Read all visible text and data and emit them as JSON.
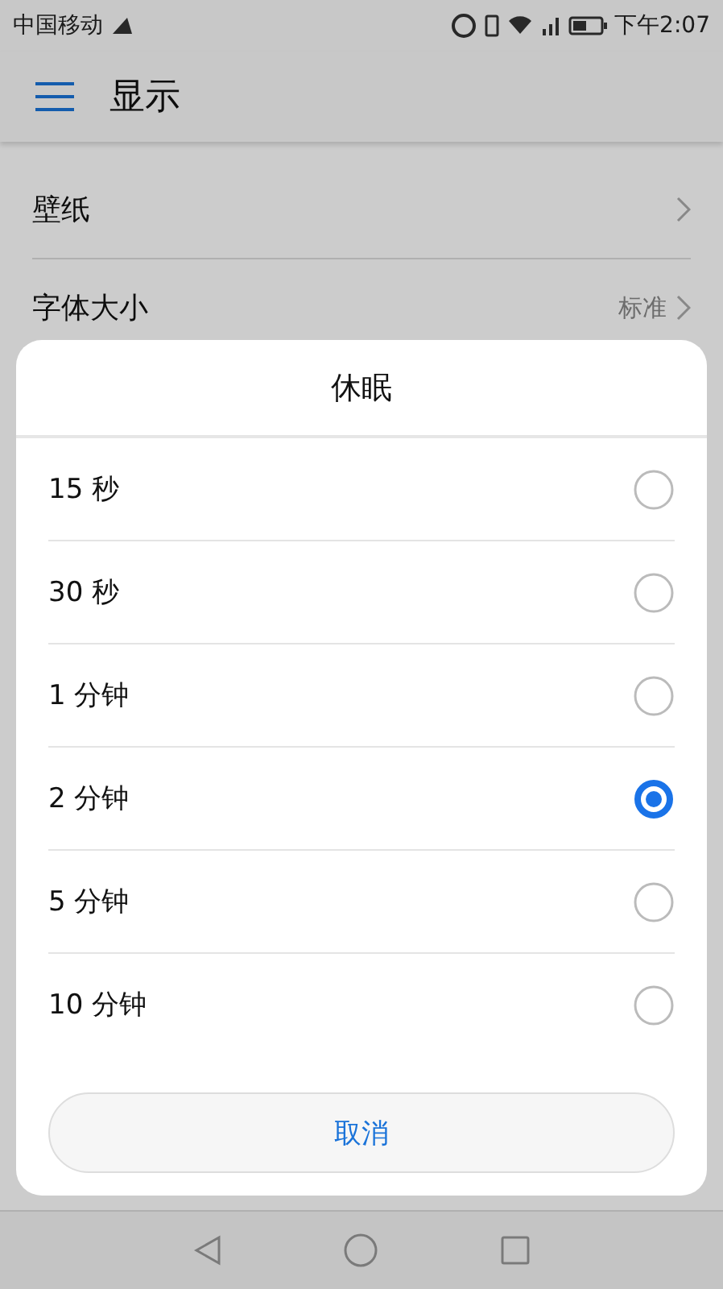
{
  "status_bar": {
    "carrier": "中国移动",
    "time": "下午2:07"
  },
  "app_bar": {
    "title": "显示"
  },
  "settings": [
    {
      "label": "壁纸"
    },
    {
      "label": "字体大小",
      "value": "标准"
    }
  ],
  "dialog": {
    "title": "休眠",
    "options": [
      {
        "label": "15 秒",
        "selected": false
      },
      {
        "label": "30 秒",
        "selected": false
      },
      {
        "label": "1 分钟",
        "selected": false
      },
      {
        "label": "2 分钟",
        "selected": true
      },
      {
        "label": "5 分钟",
        "selected": false
      },
      {
        "label": "10 分钟",
        "selected": false
      }
    ],
    "cancel": "取消"
  }
}
